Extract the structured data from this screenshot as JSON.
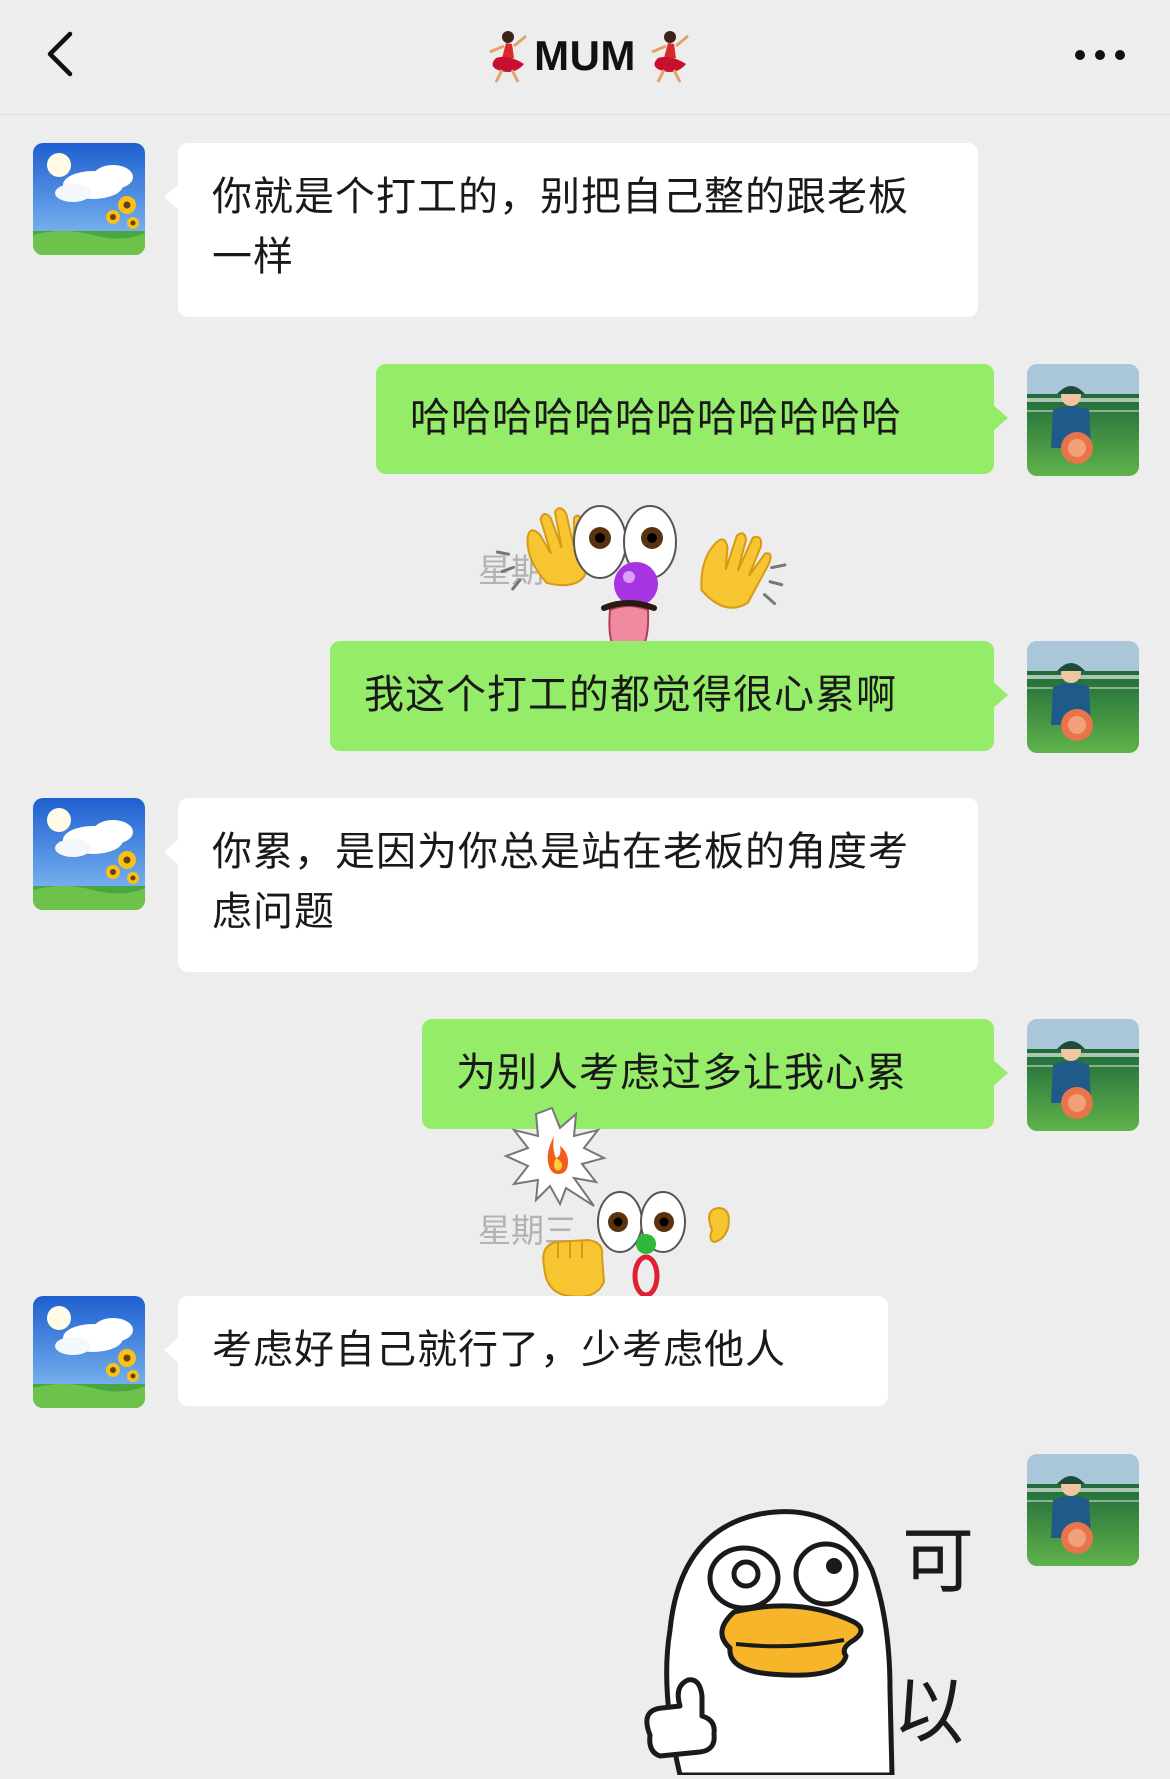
{
  "header": {
    "title": "MUM",
    "left_decoration": "dancer-emoji",
    "right_decoration": "dancer-emoji"
  },
  "messages": [
    {
      "side": "in",
      "text": "你就是个打工的，别把自己整的跟老板一样"
    },
    {
      "side": "out",
      "text": "哈哈哈哈哈哈哈哈哈哈哈哈"
    },
    {
      "side": "out",
      "text": "我这个打工的都觉得很心累啊"
    },
    {
      "side": "in",
      "text": "你累，是因为你总是站在老板的角度考虑问题"
    },
    {
      "side": "out",
      "text": "为别人考虑过多让我心累"
    },
    {
      "side": "in",
      "text": "考虑好自己就行了，少考虑他人"
    }
  ],
  "timestamps": [
    "星期三",
    "星期三"
  ],
  "sticker": {
    "text_top": "可",
    "text_bottom": "以"
  },
  "colors": {
    "background": "#ededed",
    "incoming_bubble": "#ffffff",
    "outgoing_bubble": "#95ec69",
    "timestamp": "#b2b2b2"
  }
}
